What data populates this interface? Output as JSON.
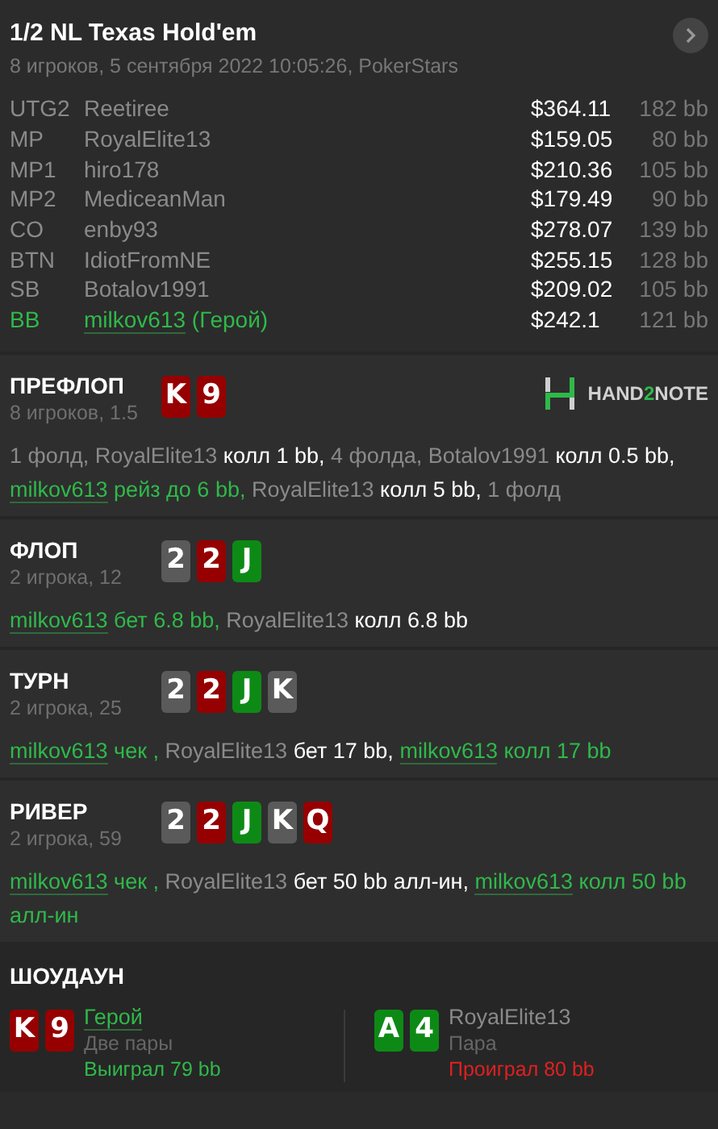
{
  "header": {
    "title": "1/2 NL Texas Hold'em",
    "subtitle": "8 игроков, 5 сентября 2022 10:05:26, PokerStars"
  },
  "players": [
    {
      "position": "UTG2",
      "name": "Reetiree",
      "stack": "$364.11",
      "bb": "182 bb",
      "hero": false
    },
    {
      "position": "MP",
      "name": "RoyalElite13",
      "stack": "$159.05",
      "bb": "80 bb",
      "hero": false
    },
    {
      "position": "MP1",
      "name": "hiro178",
      "stack": "$210.36",
      "bb": "105 bb",
      "hero": false
    },
    {
      "position": "MP2",
      "name": "MediceanMan",
      "stack": "$179.49",
      "bb": "90 bb",
      "hero": false
    },
    {
      "position": "CO",
      "name": "enby93",
      "stack": "$278.07",
      "bb": "139 bb",
      "hero": false
    },
    {
      "position": "BTN",
      "name": "IdiotFromNE",
      "stack": "$255.15",
      "bb": "128 bb",
      "hero": false
    },
    {
      "position": "SB",
      "name": "Botalov1991",
      "stack": "$209.02",
      "bb": "105 bb",
      "hero": false
    },
    {
      "position": "BB",
      "name": "milkov613",
      "note": "(Герой)",
      "stack": "$242.1",
      "bb": "121 bb",
      "hero": true
    }
  ],
  "logo": [
    "HAND",
    "2",
    "NOTE"
  ],
  "streets": [
    {
      "title": "ПРЕФЛОП",
      "info": "8 игроков, 1.5",
      "cards": [
        {
          "rank": "K",
          "color": "#960000"
        },
        {
          "rank": "9",
          "color": "#960000"
        }
      ],
      "logo": true,
      "actions": [
        {
          "kind": "muted",
          "text": "1 фолд,"
        },
        {
          "kind": "muted",
          "text": "RoyalElite13"
        },
        {
          "kind": "strong",
          "text": "колл 1 bb,"
        },
        {
          "kind": "muted",
          "text": "4 фолда,"
        },
        {
          "kind": "muted",
          "text": "Botalov1991"
        },
        {
          "kind": "strong",
          "text": "колл 0.5 bb,"
        },
        {
          "kind": "hero_name",
          "text": "milkov613"
        },
        {
          "kind": "hero",
          "text": "рейз до 6 bb,"
        },
        {
          "kind": "muted",
          "text": "RoyalElite13"
        },
        {
          "kind": "strong",
          "text": "колл 5 bb,"
        },
        {
          "kind": "muted",
          "text": "1 фолд"
        }
      ]
    },
    {
      "title": "ФЛОП",
      "info": "2 игрока, 12",
      "cards": [
        {
          "rank": "2",
          "color": "#5a5a5a"
        },
        {
          "rank": "2",
          "color": "#960000"
        },
        {
          "rank": "J",
          "color": "#0d8a16"
        }
      ],
      "logo": false,
      "actions": [
        {
          "kind": "hero_name",
          "text": "milkov613"
        },
        {
          "kind": "hero",
          "text": "бет 6.8 bb,"
        },
        {
          "kind": "muted",
          "text": "RoyalElite13"
        },
        {
          "kind": "strong",
          "text": "колл 6.8 bb"
        }
      ]
    },
    {
      "title": "ТУРН",
      "info": "2 игрока, 25",
      "cards": [
        {
          "rank": "2",
          "color": "#5a5a5a"
        },
        {
          "rank": "2",
          "color": "#960000"
        },
        {
          "rank": "J",
          "color": "#0d8a16"
        },
        {
          "rank": "K",
          "color": "#5a5a5a"
        }
      ],
      "logo": false,
      "actions": [
        {
          "kind": "hero_name",
          "text": "milkov613"
        },
        {
          "kind": "hero",
          "text": "чек ,"
        },
        {
          "kind": "muted",
          "text": "RoyalElite13"
        },
        {
          "kind": "strong",
          "text": "бет 17 bb,"
        },
        {
          "kind": "hero_name",
          "text": "milkov613"
        },
        {
          "kind": "hero",
          "text": "колл 17 bb"
        }
      ]
    },
    {
      "title": "РИВЕР",
      "info": "2 игрока, 59",
      "cards": [
        {
          "rank": "2",
          "color": "#5a5a5a"
        },
        {
          "rank": "2",
          "color": "#960000"
        },
        {
          "rank": "J",
          "color": "#0d8a16"
        },
        {
          "rank": "K",
          "color": "#5a5a5a"
        },
        {
          "rank": "Q",
          "color": "#960000"
        }
      ],
      "logo": false,
      "actions": [
        {
          "kind": "hero_name",
          "text": "milkov613"
        },
        {
          "kind": "hero",
          "text": "чек ,"
        },
        {
          "kind": "muted",
          "text": "RoyalElite13"
        },
        {
          "kind": "strong",
          "text": "бет 50 bb алл-ин,"
        },
        {
          "kind": "hero_name",
          "text": "milkov613"
        },
        {
          "kind": "hero",
          "text": "колл 50 bb алл-ин"
        }
      ]
    }
  ],
  "showdown": {
    "title": "ШОУДАУН",
    "hands": [
      {
        "cards": [
          {
            "rank": "K",
            "color": "#960000"
          },
          {
            "rank": "9",
            "color": "#960000"
          }
        ],
        "name": "Герой",
        "hero": true,
        "hand": "Две пары",
        "result": "Выиграл 79 bb",
        "won": true
      },
      {
        "cards": [
          {
            "rank": "A",
            "color": "#0d8a16"
          },
          {
            "rank": "4",
            "color": "#0d8a16"
          }
        ],
        "name": "RoyalElite13",
        "hero": false,
        "hand": "Пара",
        "result": "Проиграл 80 bb",
        "won": false
      }
    ]
  }
}
